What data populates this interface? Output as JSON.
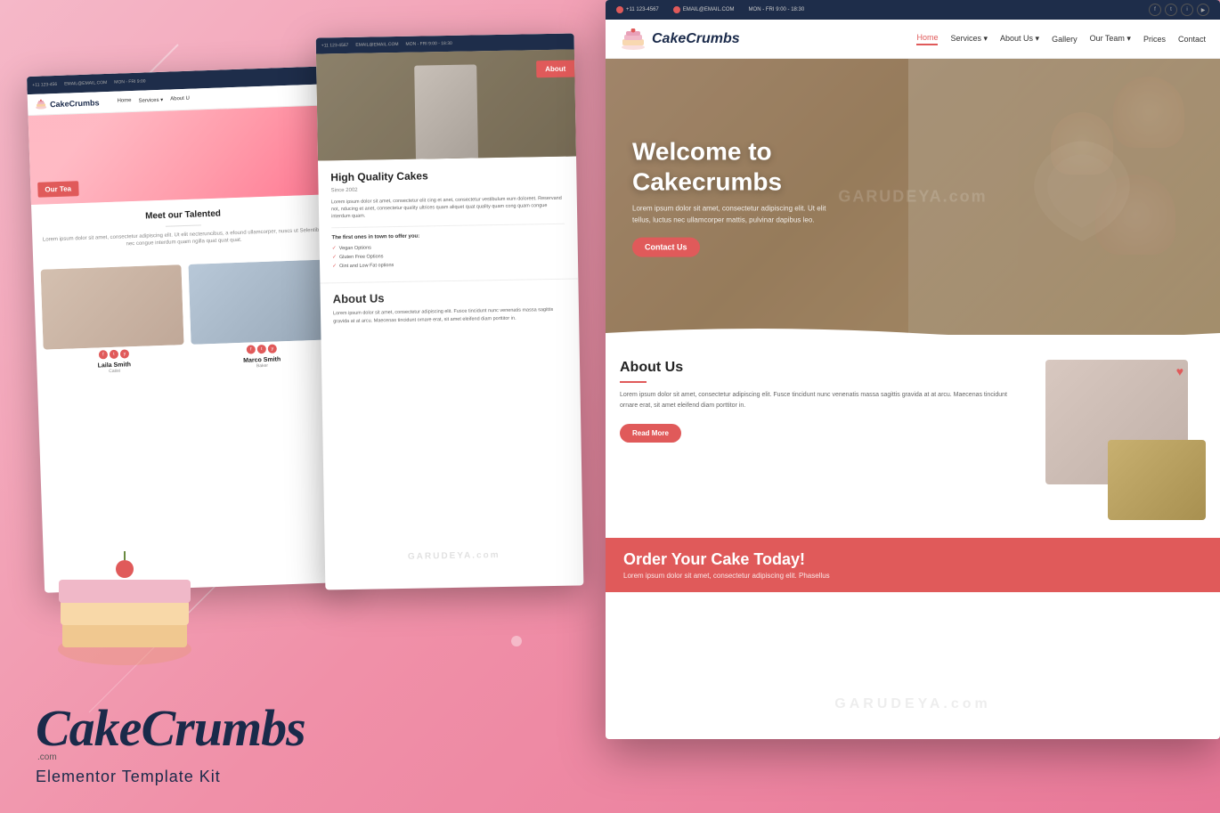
{
  "brand": {
    "name": "CakeCrumbs",
    "name_part1": "Cake",
    "name_part2": "Crumbs",
    "subtitle": "Elementor Template Kit",
    "dot_com": ".com"
  },
  "topbar": {
    "phone": "+11 123-4567",
    "email": "EMAIL@EMAIL.COM",
    "hours": "MON - FRI 9:00 - 18:30"
  },
  "nav": {
    "logo": "CakeCrumbs",
    "items": [
      {
        "label": "Home",
        "active": true
      },
      {
        "label": "Services",
        "has_dropdown": true
      },
      {
        "label": "About Us",
        "has_dropdown": true
      },
      {
        "label": "Gallery"
      },
      {
        "label": "Our Team",
        "has_dropdown": true
      },
      {
        "label": "Prices"
      },
      {
        "label": "Contact"
      }
    ]
  },
  "hero": {
    "title_line1": "Welcome to",
    "title_line2": "Cakecrumbs",
    "subtitle": "Lorem ipsum dolor sit amet, consectetur adipiscing elit. Ut elit\ntellus, luctus nec ullamcorper mattis, pulvinar dapibus leo.",
    "cta_button": "Contact Us",
    "watermark": "GARUDEYA.com"
  },
  "about": {
    "section_title": "About Us",
    "body_text": "Lorem ipsum dolor sit amet, consectetur\nadipiscing elit. Fusce tincidunt nunc venenatis\nmassa sagittis gravida at at arcu. Maecenas\ntincidunt ornare erat, sit amet eleifend diam\nporttitor in.",
    "read_more": "Read More",
    "heart_icon": "♥"
  },
  "team": {
    "section_title": "Meet our Talented",
    "subtitle_text": "Lorem ipsum dolor sit amet, consectetur adipiscing elit. Ut elit\nnecteruncibus, a efound ullamcorper, nuscs ut Selentibus nec\ncongue interdum quam ngilla quat quat quat.",
    "members": [
      {
        "name": "Laila Smith",
        "role": "Catist"
      },
      {
        "name": "Marco Smith",
        "role": "Baker"
      }
    ]
  },
  "quality": {
    "title": "High Quality Cakes",
    "subtitle": "Since 2002",
    "description": "Lorem ipsum dolor sit amet, consectetur\nelit cing et anet, consectetur vestibulum eum doloreet.\nReserved not, nducing et anet, consectetur quality\nultrices quam aliquet quat quality quam cong quam\ncongue interdum quam.",
    "cta_label": "The first ones in town to offer you:",
    "features": [
      "Vegan Options",
      "Gluten Free Options",
      "Oint and Low Fat options"
    ]
  },
  "order_cta": {
    "title": "Order Your Cake Today!",
    "text": "Lorem ipsum dolor sit amet, consectetur adipiscing elit. Phasellus"
  },
  "back_nav": {
    "logo": "CakeCrumbs",
    "items": [
      "Home",
      "Services",
      "About U"
    ]
  },
  "back_hero_badge": "Our Tea",
  "watermark_garudeya": "GARUDEYA",
  "watermark_garudeya2": "garudeya",
  "colors": {
    "accent": "#e05a5a",
    "dark_navy": "#1e2d4a",
    "pink_bg": "#f090a8",
    "text_dark": "#222222",
    "text_muted": "#666666"
  }
}
